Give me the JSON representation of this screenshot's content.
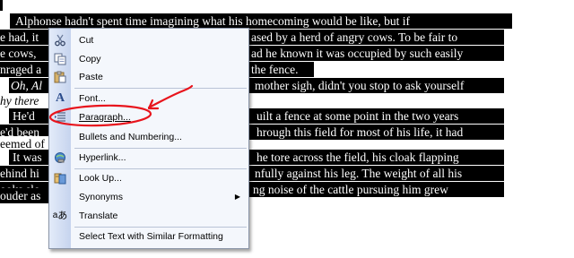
{
  "document": {
    "lines": [
      {
        "text": "Alphonse hadn't spent time imagining what his homecoming would be like, but if",
        "italic": false
      },
      {
        "text": "e had, it",
        "italic": false
      },
      {
        "text": "ased by a herd of angry cows. To be fair to",
        "italic": false
      },
      {
        "text": "e cows,",
        "italic": false
      },
      {
        "text": "ad he known it was occupied by such easily",
        "italic": false
      },
      {
        "text": "nraged a",
        "italic": false
      },
      {
        "text": "the fence.",
        "italic": false
      },
      {
        "text": "Oh, Al",
        "italic": true
      },
      {
        "text": "mother sigh, didn't you stop to ask yourself",
        "italic": false
      },
      {
        "text": "hy there",
        "italic": true
      },
      {
        "text": "He'd",
        "italic": false
      },
      {
        "text": "uilt a fence at some point in the two years",
        "italic": false
      },
      {
        "text": "e'd been",
        "italic": false
      },
      {
        "text": "hrough this field for most of his life, it had",
        "italic": false
      },
      {
        "text": "eemed of",
        "italic": false
      },
      {
        "text": "It was",
        "italic": false
      },
      {
        "text": "he tore across the field, his cloak flapping",
        "italic": false
      },
      {
        "text": "ehind hi",
        "italic": false
      },
      {
        "text": "nfully against his leg. The weight of all his",
        "italic": false
      },
      {
        "text": "ooks slo",
        "italic": false
      },
      {
        "text": "ng noise of the cattle pursuing him grew",
        "italic": false
      },
      {
        "text": "ouder as",
        "italic": false
      }
    ]
  },
  "context_menu": {
    "items": [
      {
        "label": "Cut",
        "icon": "scissors-icon"
      },
      {
        "label": "Copy",
        "icon": "copy-icon"
      },
      {
        "label": "Paste",
        "icon": "paste-icon"
      },
      {
        "label": "Font...",
        "icon": "font-icon"
      },
      {
        "label": "Paragraph...",
        "icon": "paragraph-icon"
      },
      {
        "label": "Bullets and Numbering...",
        "icon": "none"
      },
      {
        "label": "Hyperlink...",
        "icon": "hyperlink-icon"
      },
      {
        "label": "Look Up...",
        "icon": "research-icon"
      },
      {
        "label": "Synonyms",
        "icon": "none"
      },
      {
        "label": "Translate",
        "icon": "translate-icon"
      },
      {
        "label": "Select Text with Similar Formatting",
        "icon": "none"
      }
    ]
  },
  "colors": {
    "selection": "#000000",
    "annotation": "#e8141c",
    "menu_bg": "#f4f7fc",
    "gutter": "#c6d4ee"
  }
}
